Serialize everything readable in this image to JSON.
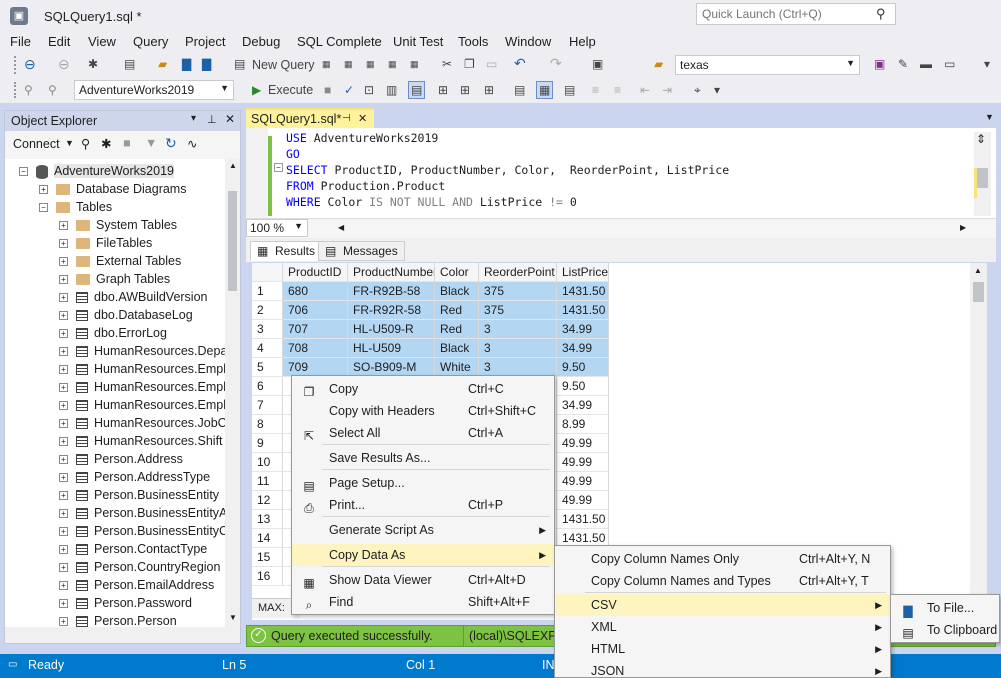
{
  "window": {
    "title": "SQLQuery1.sql *",
    "app_icon": "ssms-icon"
  },
  "quick_launch": {
    "placeholder": "Quick Launch (Ctrl+Q)"
  },
  "menu": [
    "File",
    "Edit",
    "View",
    "Query",
    "Project",
    "Debug",
    "SQL Complete",
    "Unit Test",
    "Tools",
    "Window",
    "Help"
  ],
  "toolbar": {
    "new_query": "New Query",
    "search_value": "texas",
    "database": "AdventureWorks2019",
    "execute": "Execute"
  },
  "object_explorer": {
    "title": "Object Explorer",
    "connect": "Connect",
    "tree": [
      {
        "label": "AdventureWorks2019",
        "level": 0,
        "expander": "−",
        "icon": "database-icon"
      },
      {
        "label": "Database Diagrams",
        "level": 1,
        "expander": "+",
        "icon": "folder-icon"
      },
      {
        "label": "Tables",
        "level": 1,
        "expander": "−",
        "icon": "folder-icon"
      },
      {
        "label": "System Tables",
        "level": 2,
        "expander": "+",
        "icon": "folder-icon"
      },
      {
        "label": "FileTables",
        "level": 2,
        "expander": "+",
        "icon": "folder-icon"
      },
      {
        "label": "External Tables",
        "level": 2,
        "expander": "+",
        "icon": "folder-icon"
      },
      {
        "label": "Graph Tables",
        "level": 2,
        "expander": "+",
        "icon": "folder-icon"
      },
      {
        "label": "dbo.AWBuildVersion",
        "level": 2,
        "expander": "+",
        "icon": "table-icon"
      },
      {
        "label": "dbo.DatabaseLog",
        "level": 2,
        "expander": "+",
        "icon": "table-icon"
      },
      {
        "label": "dbo.ErrorLog",
        "level": 2,
        "expander": "+",
        "icon": "table-icon"
      },
      {
        "label": "HumanResources.Depar",
        "level": 2,
        "expander": "+",
        "icon": "table-icon"
      },
      {
        "label": "HumanResources.Emplo",
        "level": 2,
        "expander": "+",
        "icon": "table-icon"
      },
      {
        "label": "HumanResources.Emplo",
        "level": 2,
        "expander": "+",
        "icon": "table-icon"
      },
      {
        "label": "HumanResources.Emplo",
        "level": 2,
        "expander": "+",
        "icon": "table-icon"
      },
      {
        "label": "HumanResources.JobCa",
        "level": 2,
        "expander": "+",
        "icon": "table-icon"
      },
      {
        "label": "HumanResources.Shift",
        "level": 2,
        "expander": "+",
        "icon": "table-icon"
      },
      {
        "label": "Person.Address",
        "level": 2,
        "expander": "+",
        "icon": "table-icon"
      },
      {
        "label": "Person.AddressType",
        "level": 2,
        "expander": "+",
        "icon": "table-icon"
      },
      {
        "label": "Person.BusinessEntity",
        "level": 2,
        "expander": "+",
        "icon": "table-icon"
      },
      {
        "label": "Person.BusinessEntityAc",
        "level": 2,
        "expander": "+",
        "icon": "table-icon"
      },
      {
        "label": "Person.BusinessEntityCo",
        "level": 2,
        "expander": "+",
        "icon": "table-icon"
      },
      {
        "label": "Person.ContactType",
        "level": 2,
        "expander": "+",
        "icon": "table-icon"
      },
      {
        "label": "Person.CountryRegion",
        "level": 2,
        "expander": "+",
        "icon": "table-icon"
      },
      {
        "label": "Person.EmailAddress",
        "level": 2,
        "expander": "+",
        "icon": "table-icon"
      },
      {
        "label": "Person.Password",
        "level": 2,
        "expander": "+",
        "icon": "table-icon"
      },
      {
        "label": "Person.Person",
        "level": 2,
        "expander": "+",
        "icon": "table-icon"
      }
    ]
  },
  "document_tab": {
    "label": "SQLQuery1.sql*"
  },
  "editor": {
    "lines": [
      [
        {
          "t": "USE ",
          "c": "kw"
        },
        {
          "t": "AdventureWorks2019",
          "c": ""
        }
      ],
      [
        {
          "t": "GO",
          "c": "kw"
        }
      ],
      [
        {
          "t": "SELECT ",
          "c": "kw"
        },
        {
          "t": "ProductID, ProductNumber, Color,  ReorderPoint, ListPrice",
          "c": ""
        }
      ],
      [
        {
          "t": "FROM ",
          "c": "kw"
        },
        {
          "t": "Production.Product",
          "c": ""
        }
      ],
      [
        {
          "t": "WHERE ",
          "c": "kw"
        },
        {
          "t": "Color ",
          "c": ""
        },
        {
          "t": "IS NOT NULL AND ",
          "c": "gr"
        },
        {
          "t": "ListPrice ",
          "c": ""
        },
        {
          "t": "!= ",
          "c": "gr"
        },
        {
          "t": "0",
          "c": ""
        }
      ]
    ],
    "zoom": "100 %"
  },
  "result_tabs": {
    "results": "Results",
    "messages": "Messages"
  },
  "grid": {
    "columns": [
      "ProductID",
      "ProductNumber",
      "Color",
      "ReorderPoint",
      "ListPrice"
    ],
    "rows": [
      [
        "1",
        "680",
        "FR-R92B-58",
        "Black",
        "375",
        "1431.50"
      ],
      [
        "2",
        "706",
        "FR-R92R-58",
        "Red",
        "375",
        "1431.50"
      ],
      [
        "3",
        "707",
        "HL-U509-R",
        "Red",
        "3",
        "34.99"
      ],
      [
        "4",
        "708",
        "HL-U509",
        "Black",
        "3",
        "34.99"
      ],
      [
        "5",
        "709",
        "SO-B909-M",
        "White",
        "3",
        "9.50"
      ],
      [
        "6",
        "",
        "",
        "",
        "",
        "9.50"
      ],
      [
        "7",
        "",
        "",
        "",
        "",
        "34.99"
      ],
      [
        "8",
        "",
        "",
        "",
        "",
        "8.99"
      ],
      [
        "9",
        "",
        "",
        "",
        "",
        "49.99"
      ],
      [
        "10",
        "",
        "",
        "",
        "",
        "49.99"
      ],
      [
        "11",
        "",
        "",
        "",
        "",
        "49.99"
      ],
      [
        "12",
        "",
        "",
        "",
        "",
        "49.99"
      ],
      [
        "13",
        "",
        "",
        "",
        "",
        "1431.50"
      ],
      [
        "14",
        "",
        "",
        "",
        "",
        "1431.50"
      ],
      [
        "15",
        "",
        "",
        "",
        "",
        ""
      ],
      [
        "16",
        "",
        "",
        "",
        "",
        ""
      ]
    ],
    "footer": "MAX: "
  },
  "query_status": {
    "message": "Query executed successfully.",
    "server": "(local)\\SQLEXPR"
  },
  "status_bar": {
    "ready": "Ready",
    "ln": "Ln 5",
    "col": "Col 1",
    "ins": "IN"
  },
  "context_menu": [
    {
      "label": "Copy",
      "shortcut": "Ctrl+C",
      "icon": "copy-icon"
    },
    {
      "label": "Copy with Headers",
      "shortcut": "Ctrl+Shift+C",
      "icon": ""
    },
    {
      "label": "Select All",
      "shortcut": "Ctrl+A",
      "icon": "select-all-icon"
    },
    {
      "label": "Save Results As...",
      "shortcut": "",
      "icon": ""
    },
    {
      "label": "Page Setup...",
      "shortcut": "",
      "icon": "page-setup-icon"
    },
    {
      "label": "Print...",
      "shortcut": "Ctrl+P",
      "icon": "print-icon"
    },
    {
      "label": "Generate Script As",
      "shortcut": "",
      "icon": ""
    },
    {
      "label": "Copy Data As",
      "shortcut": "",
      "icon": ""
    },
    {
      "label": "Show Data Viewer",
      "shortcut": "Ctrl+Alt+D",
      "icon": "data-viewer-icon"
    },
    {
      "label": "Find",
      "shortcut": "Shift+Alt+F",
      "icon": "find-icon"
    }
  ],
  "copy_data_submenu": [
    {
      "label": "Copy Column Names Only",
      "shortcut": "Ctrl+Alt+Y, N"
    },
    {
      "label": "Copy Column Names and Types",
      "shortcut": "Ctrl+Alt+Y, T"
    },
    {
      "label": "CSV",
      "shortcut": ""
    },
    {
      "label": "XML",
      "shortcut": ""
    },
    {
      "label": "HTML",
      "shortcut": ""
    },
    {
      "label": "JSON",
      "shortcut": ""
    }
  ],
  "csv_submenu": [
    {
      "label": "To File...",
      "icon": "save-icon"
    },
    {
      "label": "To Clipboard",
      "icon": "clipboard-icon"
    }
  ]
}
